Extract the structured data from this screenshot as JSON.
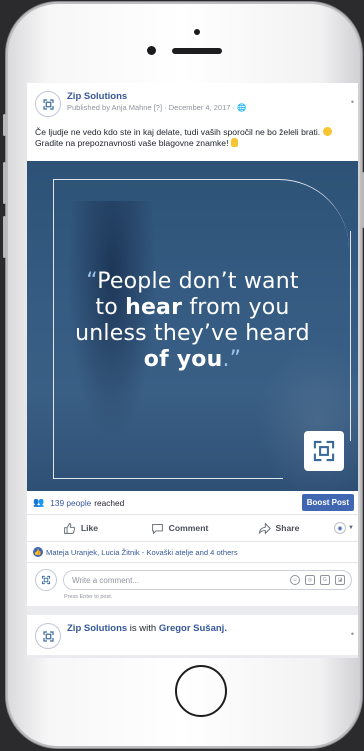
{
  "post": {
    "page_name": "Zip Solutions",
    "meta": "Published by Anja Mahne [?] · December 4, 2017 · ",
    "caption_1": "Če ljudje ne vedo kdo ste in kaj delate, tudi vaših sporočil ne bo želeli brati. ",
    "caption_2": " Gradite na prepoznavnosti vaše blagovne znamke! ",
    "image": {
      "quote_open": "“",
      "line1": "People don’t want",
      "line2_pre": "to ",
      "line2_bold": "hear",
      "line2_post": " from you",
      "line3": "unless they’ve heard",
      "line4_bold": "of you",
      "quote_close": ".”"
    },
    "reach_count": "139 people",
    "reach_suffix": "reached",
    "boost_label": "Boost Post",
    "actions": {
      "like": "Like",
      "comment": "Comment",
      "share": "Share"
    },
    "likes_text": "Mateja Uranjek, Lucia Žitnik - Kovaški atelje and 4 others",
    "comment_placeholder": "Write a comment...",
    "press_enter": "Press Enter to post."
  },
  "post2": {
    "page_name": "Zip Solutions",
    "with_text": " is with ",
    "tagged": "Gregor Sušanj."
  },
  "colors": {
    "link": "#365899",
    "boost": "#4267b2",
    "image_bg": "#355b82"
  }
}
